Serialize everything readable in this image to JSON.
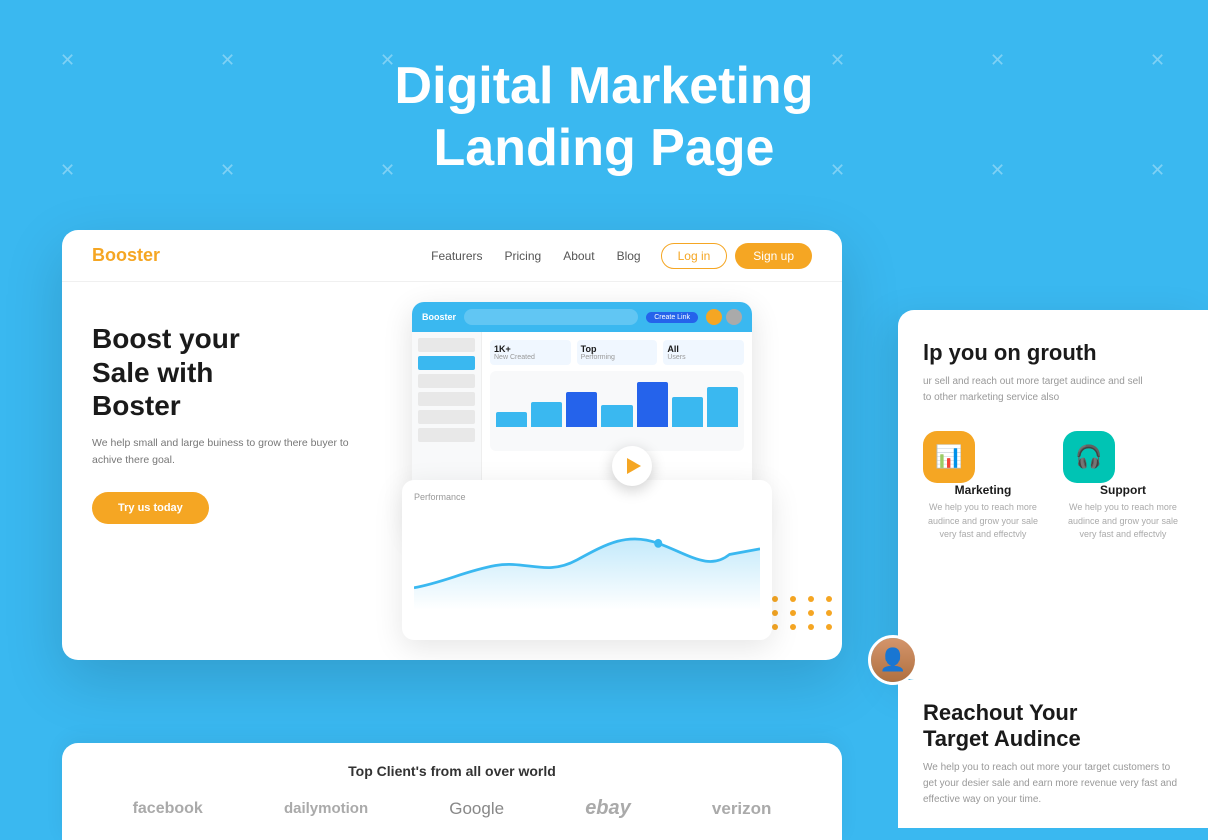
{
  "page": {
    "title_line1": "Digital Marketing",
    "title_line2": "Landing Page",
    "background_color": "#3ab8f0"
  },
  "nav": {
    "logo": "Booster",
    "logo_highlight": "B",
    "links": [
      "Featurers",
      "Pricing",
      "About",
      "Blog"
    ],
    "login_label": "Log in",
    "signup_label": "Sign up"
  },
  "hero": {
    "title_line1": "Boost your",
    "title_line2": "Sale with",
    "title_line3": "Boster",
    "subtitle": "We help small and large buiness to grow there buyer to achive there goal.",
    "cta_label": "Try us today"
  },
  "features": {
    "title": "lp you on grouth",
    "description": "ur sell and reach out more target audince and sell\no other marketing service also",
    "items": [
      {
        "name": "Marketing",
        "icon": "📊",
        "icon_bg": "orange",
        "description": "We help you to reach more audince and grow your sale very fast and effectvly"
      },
      {
        "name": "Support",
        "icon": "🎧",
        "icon_bg": "teal",
        "description": "We help you to reach more audince and grow your sale very fast and effectvly"
      }
    ]
  },
  "reachout": {
    "title_line1": "Reachout Your",
    "title_line2": "Target Audince",
    "description": "We help you to reach out more your target customers to get your desier sale and earn more revenue very fast and effective way on your time."
  },
  "clients": {
    "section_title": "Top Client's from all over world",
    "logos": [
      "facebook",
      "dailymotion",
      "Google",
      "ebay",
      "verizon"
    ]
  },
  "dashboard": {
    "logo": "Booster",
    "stats": [
      {
        "value": "1K+",
        "label": "New Created"
      },
      {
        "value": "Top",
        "label": "Performing"
      },
      {
        "value": "All Users"
      }
    ],
    "bars": [
      30,
      50,
      70,
      45,
      80,
      60,
      90
    ],
    "line_chart_label": "Performance"
  }
}
